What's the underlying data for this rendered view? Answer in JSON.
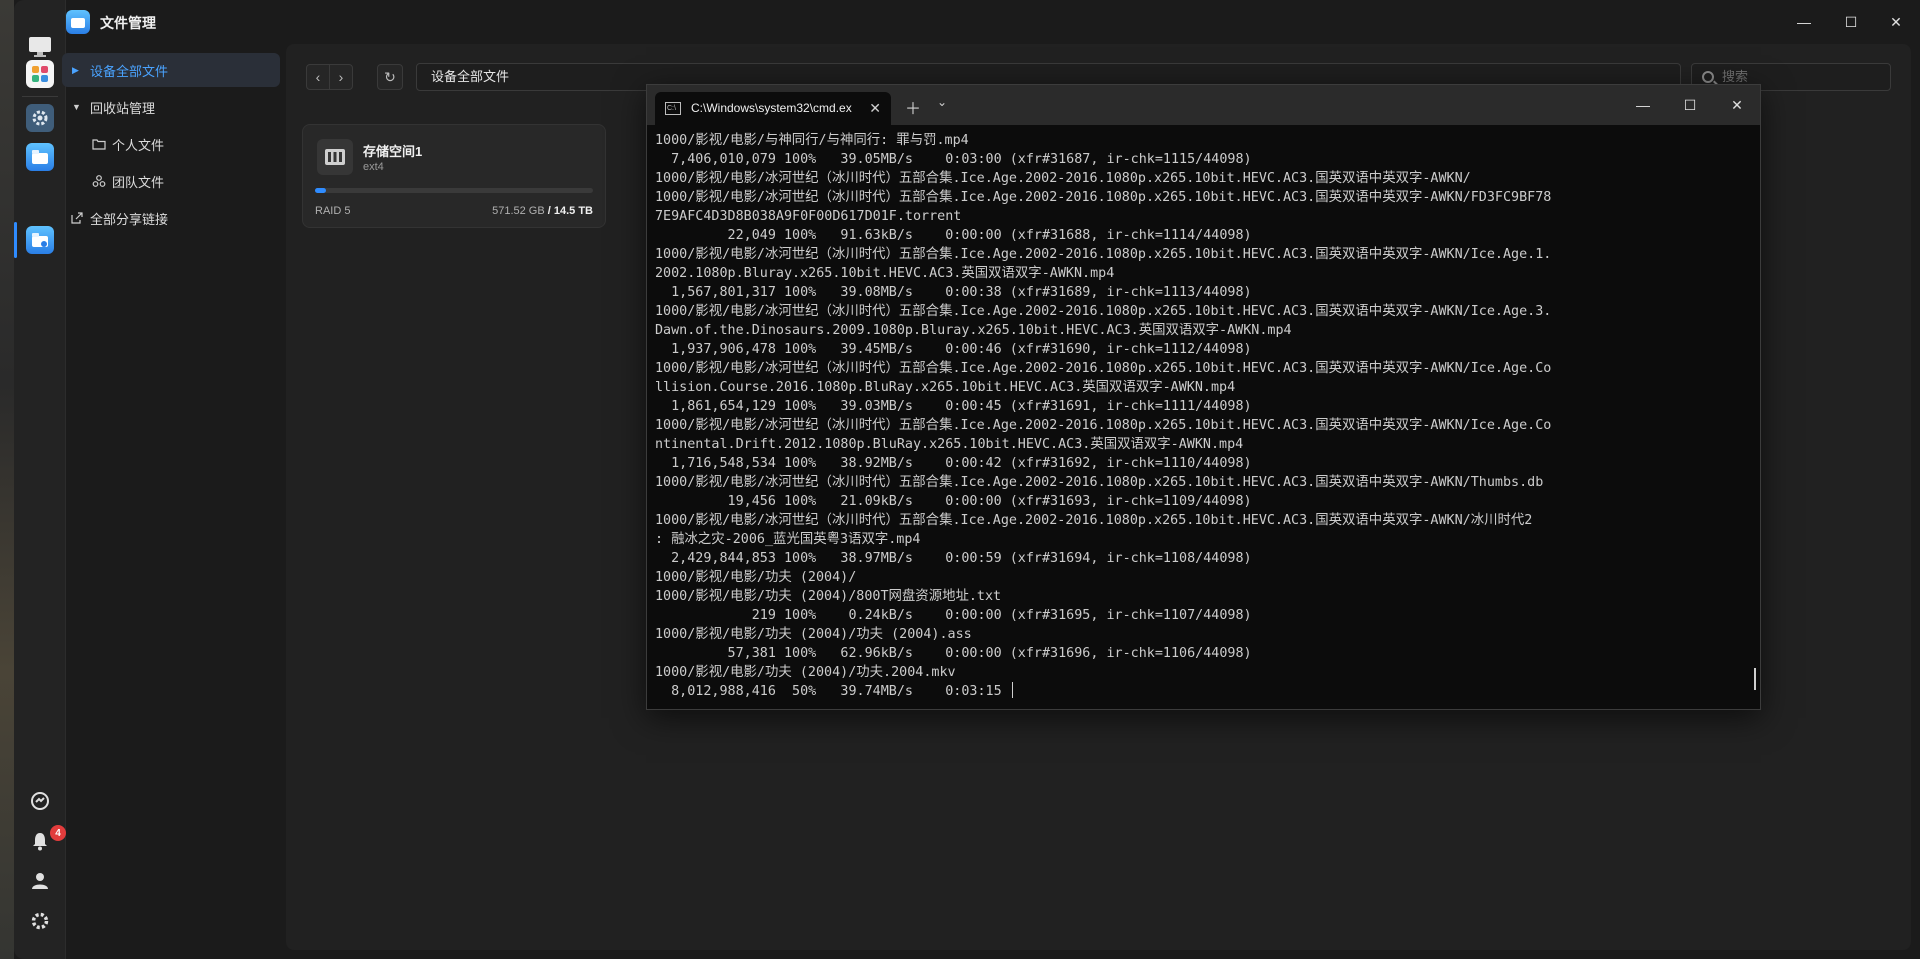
{
  "app": {
    "title": "文件管理",
    "window_controls": {
      "minimize": "—",
      "maximize": "☐",
      "close": "✕"
    }
  },
  "dock": {
    "items": [
      "desktop-icon",
      "app-center-icon",
      "settings-icon",
      "files-icon",
      "file-manager-icon"
    ],
    "bottom": [
      "update-icon",
      "bell-icon",
      "user-icon",
      "gear-icon"
    ],
    "notification_count": "4"
  },
  "sidebar": {
    "items": [
      {
        "label": "设备全部文件",
        "active": true
      },
      {
        "label": "回收站管理"
      },
      {
        "label": "个人文件"
      },
      {
        "label": "团队文件"
      },
      {
        "label": "全部分享链接"
      }
    ]
  },
  "toolbar": {
    "back": "‹",
    "forward": "›",
    "refresh": "↻",
    "path": "设备全部文件",
    "search_placeholder": "搜索"
  },
  "storage": {
    "name": "存储空间1",
    "fs": "ext4",
    "raid": "RAID 5",
    "used": "571.52 GB",
    "total": "/ 14.5 TB",
    "usage_fraction": 0.04
  },
  "cmd": {
    "tab_title": "C:\\Windows\\system32\\cmd.ex",
    "tab_icon": "C:\\",
    "lines": [
      "1000/影视/电影/与神同行/与神同行: 罪与罚.mp4",
      "  7,406,010,079 100%   39.05MB/s    0:03:00 (xfr#31687, ir-chk=1115/44098)",
      "1000/影视/电影/冰河世纪（冰川时代）五部合集.Ice.Age.2002-2016.1080p.x265.10bit.HEVC.AC3.国英双语中英双字-AWKN/",
      "1000/影视/电影/冰河世纪（冰川时代）五部合集.Ice.Age.2002-2016.1080p.x265.10bit.HEVC.AC3.国英双语中英双字-AWKN/FD3FC9BF78",
      "7E9AFC4D3D8B038A9F0F00D617D01F.torrent",
      "         22,049 100%   91.63kB/s    0:00:00 (xfr#31688, ir-chk=1114/44098)",
      "1000/影视/电影/冰河世纪（冰川时代）五部合集.Ice.Age.2002-2016.1080p.x265.10bit.HEVC.AC3.国英双语中英双字-AWKN/Ice.Age.1.",
      "2002.1080p.Bluray.x265.10bit.HEVC.AC3.英国双语双字-AWKN.mp4",
      "  1,567,801,317 100%   39.08MB/s    0:00:38 (xfr#31689, ir-chk=1113/44098)",
      "1000/影视/电影/冰河世纪（冰川时代）五部合集.Ice.Age.2002-2016.1080p.x265.10bit.HEVC.AC3.国英双语中英双字-AWKN/Ice.Age.3.",
      "Dawn.of.the.Dinosaurs.2009.1080p.Bluray.x265.10bit.HEVC.AC3.英国双语双字-AWKN.mp4",
      "  1,937,906,478 100%   39.45MB/s    0:00:46 (xfr#31690, ir-chk=1112/44098)",
      "1000/影视/电影/冰河世纪（冰川时代）五部合集.Ice.Age.2002-2016.1080p.x265.10bit.HEVC.AC3.国英双语中英双字-AWKN/Ice.Age.Co",
      "llision.Course.2016.1080p.BluRay.x265.10bit.HEVC.AC3.英国双语双字-AWKN.mp4",
      "  1,861,654,129 100%   39.03MB/s    0:00:45 (xfr#31691, ir-chk=1111/44098)",
      "1000/影视/电影/冰河世纪（冰川时代）五部合集.Ice.Age.2002-2016.1080p.x265.10bit.HEVC.AC3.国英双语中英双字-AWKN/Ice.Age.Co",
      "ntinental.Drift.2012.1080p.BluRay.x265.10bit.HEVC.AC3.英国双语双字-AWKN.mp4",
      "  1,716,548,534 100%   38.92MB/s    0:00:42 (xfr#31692, ir-chk=1110/44098)",
      "1000/影视/电影/冰河世纪（冰川时代）五部合集.Ice.Age.2002-2016.1080p.x265.10bit.HEVC.AC3.国英双语中英双字-AWKN/Thumbs.db",
      "         19,456 100%   21.09kB/s    0:00:00 (xfr#31693, ir-chk=1109/44098)",
      "1000/影视/电影/冰河世纪（冰川时代）五部合集.Ice.Age.2002-2016.1080p.x265.10bit.HEVC.AC3.国英双语中英双字-AWKN/冰川时代2",
      ": 融冰之灾-2006_蓝光国英粤3语双字.mp4",
      "  2,429,844,853 100%   38.97MB/s    0:00:59 (xfr#31694, ir-chk=1108/44098)",
      "1000/影视/电影/功夫 (2004)/",
      "1000/影视/电影/功夫 (2004)/800T网盘资源地址.txt",
      "            219 100%    0.24kB/s    0:00:00 (xfr#31695, ir-chk=1107/44098)",
      "1000/影视/电影/功夫 (2004)/功夫 (2004).ass",
      "         57,381 100%   62.96kB/s    0:00:00 (xfr#31696, ir-chk=1106/44098)",
      "1000/影视/电影/功夫 (2004)/功夫.2004.mkv",
      "  8,012,988,416  50%   39.74MB/s    0:03:15 "
    ]
  },
  "colors": {
    "accent": "#2f8cff",
    "badge": "#e23c3c",
    "terminal_bg": "#0c0c0c"
  }
}
